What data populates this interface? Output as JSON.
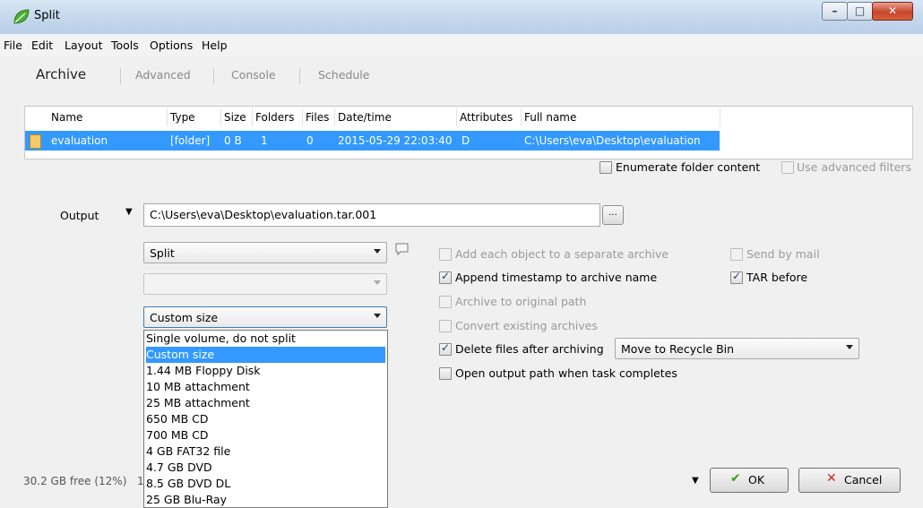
{
  "window": {
    "title": "Split"
  },
  "menu": [
    "File",
    "Edit",
    "Layout",
    "Tools",
    "Options",
    "Help"
  ],
  "tabs": [
    "Archive",
    "Advanced",
    "Console",
    "Schedule"
  ],
  "list": {
    "headers": [
      "Name",
      "Type",
      "Size",
      "Folders",
      "Files",
      "Date/time",
      "Attributes",
      "Full name"
    ],
    "row": {
      "name": "evaluation",
      "type": "[folder]",
      "size": "0 B",
      "folders": "1",
      "files": "0",
      "datetime": "2015-05-29 22:03:40",
      "attributes": "D",
      "fullname": "C:\\Users\\eva\\Desktop\\evaluation"
    }
  },
  "options_top": {
    "enumerate": "Enumerate folder content",
    "advanced_filters": "Use advanced filters"
  },
  "output": {
    "label": "Output",
    "path": "C:\\Users\\eva\\Desktop\\evaluation.tar.001",
    "browse": "..."
  },
  "combos": {
    "mode": "Split",
    "second": "",
    "size": "Custom size"
  },
  "size_options": [
    "Single volume, do not split",
    "Custom size",
    "1.44 MB Floppy Disk",
    "10 MB attachment",
    "25 MB attachment",
    "650 MB CD",
    "700 MB CD",
    "4 GB FAT32 file",
    "4.7 GB DVD",
    "8.5 GB DVD DL",
    "25 GB Blu-Ray"
  ],
  "checks": {
    "separate_archive": "Add each object to a separate archive",
    "timestamp": "Append timestamp to archive name",
    "original_path": "Archive to original path",
    "convert": "Convert existing archives",
    "delete_files": "Delete files after archiving",
    "open_output": "Open output path when task completes",
    "send_mail": "Send by mail",
    "tar_before": "TAR before"
  },
  "delete_mode": "Move to Recycle Bin",
  "status": {
    "free": "30.2 GB free (12%)",
    "trailing": "1"
  },
  "buttons": {
    "ok": "OK",
    "cancel": "Cancel"
  },
  "colors": {
    "selection": "#3399ff",
    "ok_icon": "#3aa020",
    "cancel_icon": "#d0261b"
  }
}
